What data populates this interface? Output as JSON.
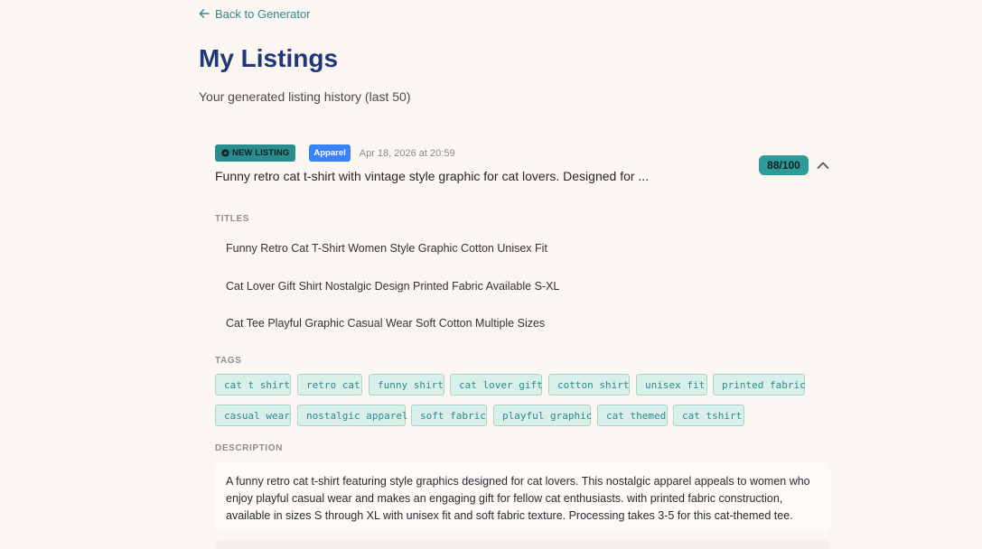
{
  "nav": {
    "back_label": "Back to Generator"
  },
  "header": {
    "title": "My Listings",
    "subtitle": "Your generated listing history (last 50)"
  },
  "listing": {
    "status_badge": "NEW LISTING",
    "category": "Apparel",
    "timestamp": "Apr 18, 2026 at 20:59",
    "summary": "Funny retro cat t-shirt with vintage style graphic for cat lovers. Designed for ...",
    "score": "88/100",
    "titles_label": "TITLES",
    "titles": [
      "Funny Retro Cat T-Shirt Women Style Graphic Cotton Unisex Fit",
      "Cat Lover Gift Shirt Nostalgic Design Printed Fabric Available S-XL",
      "Cat Tee Playful Graphic Casual Wear Soft Cotton Multiple Sizes"
    ],
    "tags_label": "TAGS",
    "tags": [
      "cat t shirt",
      "retro cat",
      "funny shirt",
      "cat lover gift",
      "cotton shirt",
      "unisex fit",
      "printed fabric",
      "casual wear",
      "nostalgic apparel",
      "soft fabric",
      "playful graphic",
      "cat themed",
      "cat tshirt"
    ],
    "description_label": "DESCRIPTION",
    "description": "A funny retro cat t-shirt featuring style graphics designed for cat lovers. This nostalgic apparel appeals to women who enjoy playful casual wear and makes an engaging gift for fellow cat enthusiasts. with printed fabric construction, available in sizes S through XL with unisex fit and soft fabric texture. Processing takes 3-5 for this cat-themed tee."
  },
  "icons": {
    "back": "arrow-left-icon",
    "new_badge": "plus-circle-icon",
    "collapse": "chevron-up-icon"
  },
  "colors": {
    "background": "#fcf6f2",
    "accent_teal": "#2a8c8d",
    "title_navy": "#1f3775",
    "category_blue": "#3b82f6",
    "tag_bg": "#d9efe9"
  }
}
